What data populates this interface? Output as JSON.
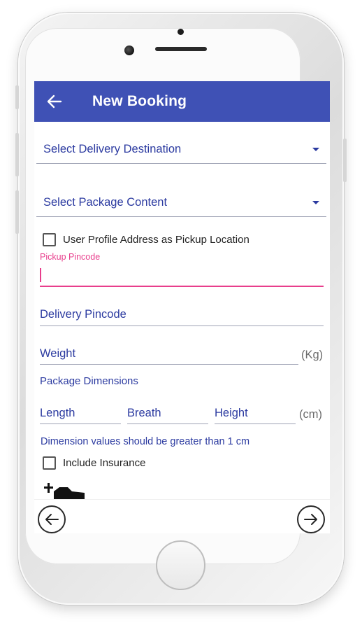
{
  "appbar": {
    "title": "New Booking",
    "back_icon": "arrow-left-icon"
  },
  "form": {
    "delivery_destination": {
      "label": "Select Delivery Destination"
    },
    "package_content": {
      "label": "Select Package Content"
    },
    "use_profile_address": {
      "label": "User Profile Address as Pickup Location",
      "checked": false
    },
    "pickup_pincode": {
      "label": "Pickup Pincode",
      "value": ""
    },
    "delivery_pincode": {
      "placeholder": "Delivery Pincode",
      "value": ""
    },
    "weight": {
      "placeholder": "Weight",
      "unit": "(Kg)",
      "value": ""
    },
    "package_dimensions_label": "Package Dimensions",
    "length": {
      "placeholder": "Length",
      "value": ""
    },
    "breath": {
      "placeholder": "Breath",
      "value": ""
    },
    "height": {
      "placeholder": "Height",
      "value": ""
    },
    "dimension_unit": "(cm)",
    "dimension_hint": "Dimension values should be greater than 1 cm",
    "include_insurance": {
      "label": "Include Insurance",
      "checked": false
    }
  },
  "bottom_nav": {
    "prev_icon": "circle-arrow-left-icon",
    "next_icon": "circle-arrow-right-icon"
  },
  "colors": {
    "primary": "#3f51b5",
    "accent": "#e83e8c",
    "text_blue": "#2b3aa0"
  }
}
